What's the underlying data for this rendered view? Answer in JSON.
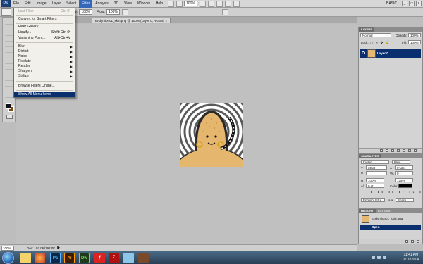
{
  "menubar": {
    "logo": "Ps",
    "items": [
      "File",
      "Edit",
      "Image",
      "Layer",
      "Select",
      "Filter",
      "Analysis",
      "3D",
      "View",
      "Window",
      "Help"
    ],
    "active": "Filter",
    "zoom": "100%",
    "workspace": "BASIC"
  },
  "options": {
    "opacity_label": "Opacity:",
    "opacity_value": "100%",
    "flow_label": "Flow:",
    "flow_value": "100%"
  },
  "document": {
    "tab_title": "Endymion01_skin.png @ 100% (Layer 0, RGB/8)"
  },
  "filter_menu": {
    "items": [
      {
        "label": "Last Filter",
        "shortcut": "Ctrl+F",
        "disabled": true
      },
      {
        "label": "Convert for Smart Filters"
      },
      {
        "label": "Filter Gallery..."
      },
      {
        "label": "Liquify...",
        "shortcut": "Shift+Ctrl+X"
      },
      {
        "label": "Vanishing Point...",
        "shortcut": "Alt+Ctrl+V"
      },
      {
        "label": "Blur",
        "submenu": true
      },
      {
        "label": "Distort",
        "submenu": true
      },
      {
        "label": "Noise",
        "submenu": true
      },
      {
        "label": "Pixelate",
        "submenu": true
      },
      {
        "label": "Render",
        "submenu": true
      },
      {
        "label": "Sharpen",
        "submenu": true
      },
      {
        "label": "Stylize",
        "submenu": true
      },
      {
        "label": "Browse Filters Online..."
      },
      {
        "label": "Show All Menu Items",
        "highlight": true
      }
    ]
  },
  "status": {
    "zoom": "100%",
    "doc_info": "Doc: 192.0K/192.0K"
  },
  "layers_panel": {
    "tab": "LAYERS",
    "blend_mode": "Normal",
    "opacity_label": "Opacity:",
    "opacity_value": "100%",
    "lock_label": "Lock:",
    "fill_label": "Fill:",
    "fill_value": "100%",
    "layer_name": "Layer 0"
  },
  "character_panel": {
    "tab": "CHARACTER",
    "font_family": "Invalid",
    "font_style": "Italic",
    "font_size": "30 pt",
    "leading": "(Auto)",
    "kerning": "",
    "tracking": "0",
    "vertical_scale": "100%",
    "horizontal_scale": "125%",
    "baseline_shift": "0 pt",
    "color_label": "Color:",
    "language": "English: USA",
    "antialias": "Sharp",
    "antialias_label": "a a"
  },
  "history_panel": {
    "tab_history": "HISTORY",
    "tab_actions": "ACTIONS",
    "snapshot": "Endymion01_skin.png",
    "step": "Open"
  },
  "taskbar": {
    "apps": [
      "Explorer",
      "Firefox",
      "Ps",
      "Ai",
      "Dw",
      "Flash",
      "FileZilla",
      "Network",
      "Game"
    ],
    "time": "11:41 AM",
    "date": "2/10/2014"
  }
}
